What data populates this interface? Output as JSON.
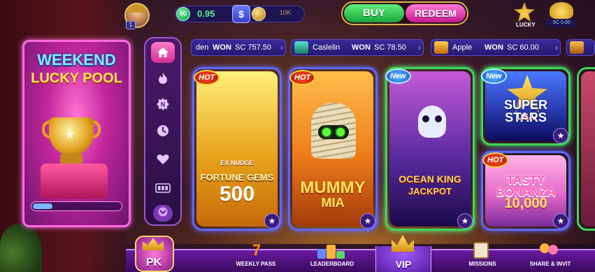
{
  "header": {
    "avatar_level": "1",
    "sc_icon": "SC",
    "sc_balance": "0.95",
    "swap_icon": "$",
    "gc_balance": "10K",
    "buy_label": "BUY",
    "redeem_label": "REDEEM",
    "lucky_label": "LUCKY",
    "treasure_value": "SC 0.00"
  },
  "ticker": [
    {
      "name": "den",
      "won": "WON",
      "amount": "SC 757.50"
    },
    {
      "name": "Caslelin",
      "won": "WON",
      "amount": "SC 78.50"
    },
    {
      "name": "Apple",
      "won": "WON",
      "amount": "SC 60.00"
    }
  ],
  "pool": {
    "line1": "WEEKEND",
    "line2": "LUCKY POOL",
    "progress": 0.22
  },
  "categories": [
    {
      "icon": "home-icon",
      "active": true
    },
    {
      "icon": "fire-icon",
      "active": false
    },
    {
      "icon": "new-icon",
      "active": false
    },
    {
      "icon": "clock-icon",
      "active": false
    },
    {
      "icon": "heart-icon",
      "active": false
    },
    {
      "icon": "jackpot-icon",
      "active": false
    }
  ],
  "games": [
    {
      "title": "FORTUNE GEMS",
      "title2": "500",
      "sub": "EX NUDGE",
      "badge": "HOT",
      "colors": [
        "#fff07a",
        "#e8a21a",
        "#c56a0a"
      ]
    },
    {
      "title": "MUMMY",
      "title2": "MIA",
      "badge": "HOT",
      "colors": [
        "#ffbe4a",
        "#ee7a1a",
        "#a23a0a"
      ]
    },
    {
      "title": "OCEAN KING",
      "title2": "JACKPOT",
      "badge": "New",
      "colors": [
        "#c45ad8",
        "#5a2aa0",
        "#1a0a4a"
      ]
    },
    {
      "title": "SUPER STARS",
      "title2": "USA",
      "badge": "New",
      "colors": [
        "#4a7aff",
        "#2a3ab0",
        "#0a0a5a"
      ]
    },
    {
      "title": "TASTY BONANZA",
      "title2": "10,000",
      "badge": "HOT",
      "colors": [
        "#ffb4e8",
        "#e46ac8",
        "#7a2a9a"
      ]
    }
  ],
  "nav": {
    "pk_label": "PK",
    "weekly_pass": "WEEKLY PASS",
    "weekly_num": "7",
    "leaderboard": "LEADERBOARD",
    "vip": "VIP",
    "missions": "MISSIONS",
    "share_invite": "SHARE & INVIT"
  }
}
